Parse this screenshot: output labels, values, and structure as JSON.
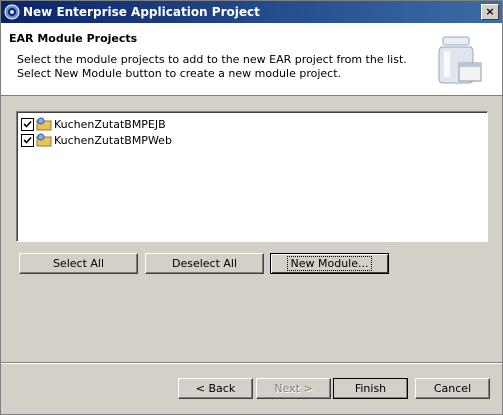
{
  "window": {
    "title": "New Enterprise Application Project",
    "close_label": "×"
  },
  "header": {
    "title": "EAR Module Projects",
    "description_line1": "Select the module projects to add to the new EAR project from the list.",
    "description_line2": "Select New Module button to create a new module project."
  },
  "module_list": {
    "items": [
      {
        "label": "KuchenZutatBMPEJB",
        "checked": true
      },
      {
        "label": "KuchenZutatBMPWeb",
        "checked": true
      }
    ]
  },
  "buttons": {
    "select_all": "Select All",
    "deselect_all": "Deselect All",
    "new_module": "New Module...",
    "back": "< Back",
    "next": "Next >",
    "finish": "Finish",
    "cancel": "Cancel"
  },
  "colors": {
    "titlebar_start": "#0a246a",
    "titlebar_end": "#3a6ea5",
    "dialog_bg": "#d4d0c8"
  }
}
